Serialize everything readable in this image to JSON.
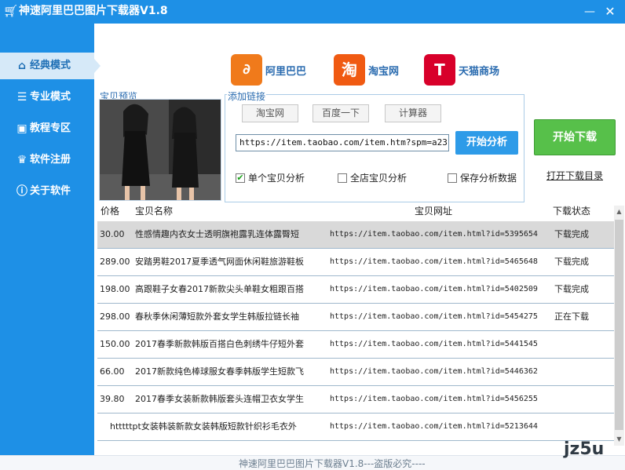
{
  "window": {
    "title": "神速阿里巴巴图片下载器V1.8",
    "minimize_glyph": "—",
    "close_glyph": "✕"
  },
  "sidebar": {
    "items": [
      {
        "label": "经典模式",
        "icon": "home-icon",
        "active": true
      },
      {
        "label": "专业模式",
        "icon": "list-icon",
        "active": false
      },
      {
        "label": "教程专区",
        "icon": "briefcase-icon",
        "active": false
      },
      {
        "label": "软件注册",
        "icon": "crown-icon",
        "active": false
      },
      {
        "label": "关于软件",
        "icon": "info-icon",
        "active": false
      }
    ]
  },
  "logos": {
    "alibaba": {
      "label": "阿里巴巴",
      "mark": "∂"
    },
    "taobao": {
      "label": "淘宝网",
      "mark": "淘"
    },
    "tmall": {
      "label": "天猫商场",
      "mark": "T"
    }
  },
  "preview": {
    "label": "宝贝预览"
  },
  "link_group": {
    "legend": "添加链接",
    "btn_taobao": "淘宝网",
    "btn_baidu": "百度一下",
    "btn_calc": "计算器",
    "url_value": "https://item.taobao.com/item.htm?spm=a23",
    "analyze_label": "开始分析",
    "check_single": {
      "label": "单个宝贝分析",
      "checked": true
    },
    "check_shop": {
      "label": "全店宝贝分析",
      "checked": false
    },
    "check_save": {
      "label": "保存分析数据",
      "checked": false
    }
  },
  "actions": {
    "start_download": "开始下载",
    "open_dir": "打开下载目录"
  },
  "table": {
    "headers": {
      "price": "价格",
      "name": "宝贝名称",
      "url": "宝贝网址",
      "status": "下载状态"
    },
    "rows": [
      {
        "price": "30.00",
        "name": "性感情趣内衣女士透明旗袍露乳连体露臀短",
        "url": "https://item.taobao.com/item.html?id=5395654",
        "status": "下载完成"
      },
      {
        "price": "289.00",
        "name": "安踏男鞋2017夏季透气网面休闲鞋旅游鞋板",
        "url": "https://item.taobao.com/item.html?id=5465648",
        "status": "下载完成"
      },
      {
        "price": "198.00",
        "name": "高跟鞋子女春2017新款尖头单鞋女粗跟百搭",
        "url": "https://item.taobao.com/item.html?id=5402509",
        "status": "下载完成"
      },
      {
        "price": "298.00",
        "name": "春秋季休闲薄短款外套女学生韩版拉链长袖",
        "url": "https://item.taobao.com/item.html?id=5454275",
        "status": "正在下载"
      },
      {
        "price": "150.00",
        "name": "2017春季新款韩版百搭白色刺绣牛仔短外套",
        "url": "https://item.taobao.com/item.html?id=5441545",
        "status": ""
      },
      {
        "price": "66.00",
        "name": "2017新款纯色棒球服女春季韩版学生短款飞",
        "url": "https://item.taobao.com/item.html?id=5446362",
        "status": ""
      },
      {
        "price": "39.80",
        "name": "2017春季女装新款韩版套头连帽卫衣女学生",
        "url": "https://item.taobao.com/item.html?id=5456255",
        "status": ""
      },
      {
        "price": "",
        "name": "htttttpt女装韩装新款女装韩版短款针织衫毛衣外",
        "url": "https://item.taobao.com/item.html?id=5213644",
        "status": ""
      }
    ]
  },
  "footer": {
    "text": "神速阿里巴巴图片下载器V1.8---盗版必究----"
  },
  "watermark": {
    "text": "jz5u"
  },
  "colors": {
    "primary": "#1e90e6",
    "start_green": "#57c04a",
    "analyze_blue": "#2e9be8"
  }
}
